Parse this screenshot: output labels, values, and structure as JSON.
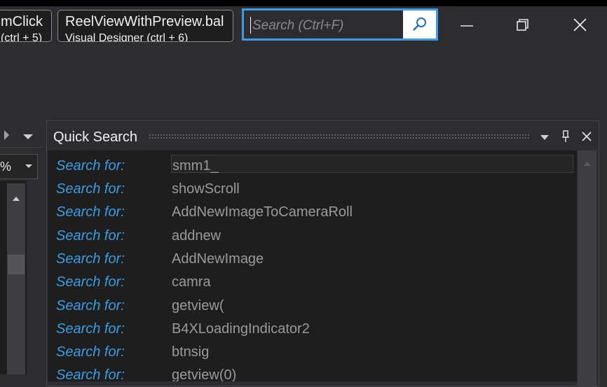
{
  "tabs": [
    {
      "line1": "mClick",
      "line2": "(ctrl + 5)"
    },
    {
      "line1": "ReelViewWithPreview.bal",
      "line2": "Visual Designer  (ctrl + 6)"
    }
  ],
  "search": {
    "placeholder": "Search (Ctrl+F)",
    "icon": "search-icon"
  },
  "window_controls": {
    "minimize_icon": "minimize-icon",
    "restore_icon": "restore-icon",
    "close_icon": "close-icon"
  },
  "left_panel": {
    "zoom_value": "%"
  },
  "quick_search": {
    "title": "Quick Search",
    "label": "Search for:",
    "items": [
      "smm1_",
      "showScroll",
      "AddNewImageToCameraRoll",
      "addnew",
      "AddNewImage",
      "camra",
      "getview(",
      "B4XLoadingIndicator2",
      "btnsig",
      "getview(0)"
    ]
  },
  "colors": {
    "accent": "#3d9be9",
    "label": "#3b9de4",
    "term": "#9a9a9a",
    "background": "#2d2d30"
  }
}
